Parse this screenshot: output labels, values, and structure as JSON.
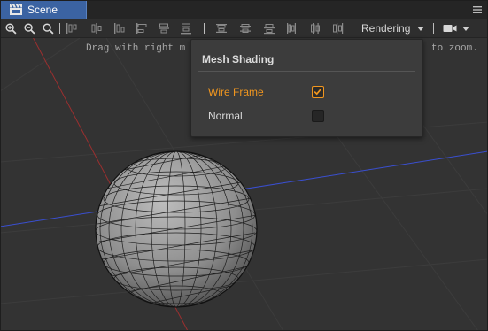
{
  "panel": {
    "tab_label": "Scene",
    "tab_icon": "scene-clapper-icon",
    "menu_icon": "hamburger-menu-icon"
  },
  "toolbar": {
    "tools": [
      "zoom-in-icon",
      "zoom-out-icon",
      "zoom-reset-icon",
      "align-top-edges-icon",
      "align-vertical-centers-icon",
      "align-bottom-edges-icon",
      "align-left-edges-icon",
      "align-horizontal-centers-icon",
      "align-right-edges-icon",
      "distribute-top-icon",
      "distribute-vertical-centers-icon",
      "distribute-bottom-icon",
      "distribute-left-icon",
      "distribute-horizontal-centers-icon",
      "distribute-right-icon"
    ],
    "rendering_label": "Rendering",
    "camera_icon": "camera-icon"
  },
  "viewport": {
    "hint_visible_start": "Drag with right m",
    "hint_visible_end": "to zoom."
  },
  "mesh_shading": {
    "title": "Mesh Shading",
    "options": [
      {
        "label": "Wire Frame",
        "checked": true
      },
      {
        "label": "Normal",
        "checked": false
      }
    ]
  },
  "colors": {
    "accent": "#f0961f",
    "tab_active": "#3b63a2",
    "grid_x_axis": "#b03030",
    "grid_z_axis": "#3a4fd0"
  }
}
